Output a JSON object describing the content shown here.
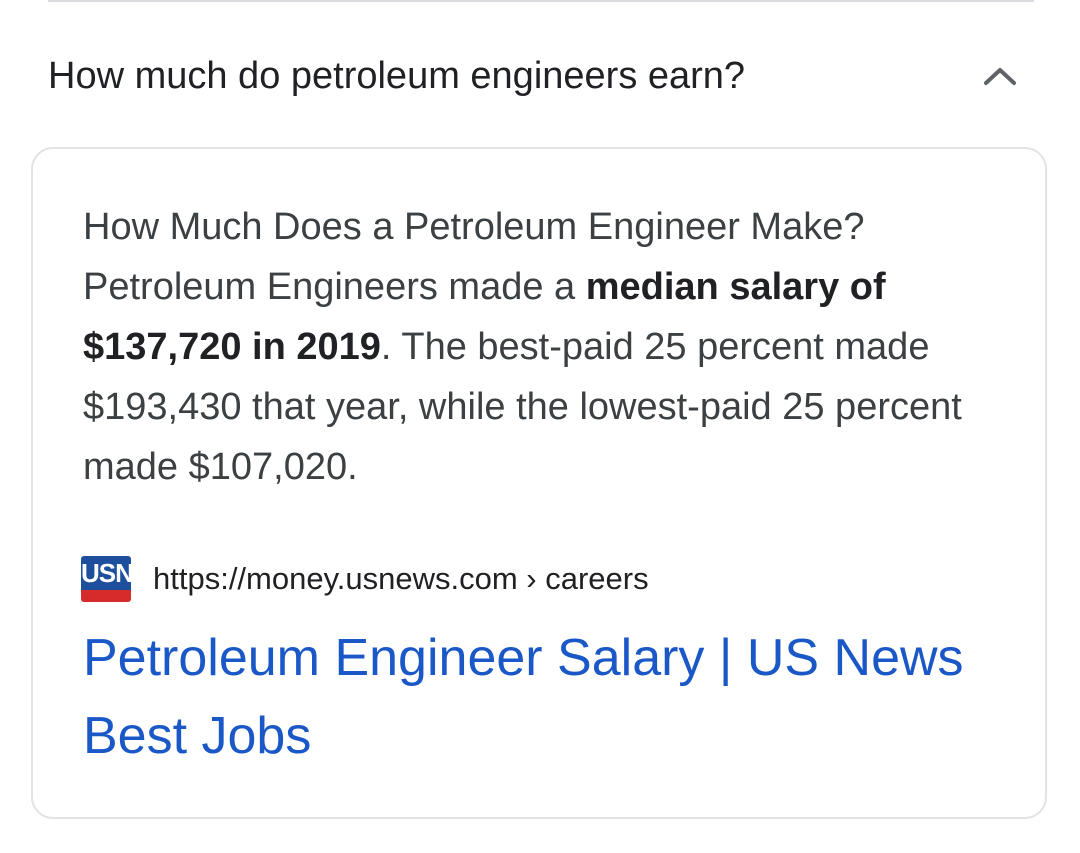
{
  "question": {
    "text": "How much do petroleum engineers earn?",
    "chevron_icon": "chevron-up-icon"
  },
  "answer": {
    "line1": "How Much Does a Petroleum Engineer Make? Petroleum Engineers made a ",
    "bold": "median salary of $137,720 in 2019",
    "line2": ". The best-paid 25 percent made $193,430 that year, while the lowest-paid 25 percent made $107,020."
  },
  "source": {
    "favicon_text": "USN",
    "favicon_icon": "usnews-logo-icon",
    "url": "https://money.usnews.com › careers"
  },
  "result": {
    "title": "Petroleum Engineer Salary | US News Best Jobs"
  },
  "colors": {
    "link": "#1a57c7",
    "text": "#3c4043",
    "favicon_blue": "#1e4f9c",
    "favicon_red": "#d62b2b"
  }
}
